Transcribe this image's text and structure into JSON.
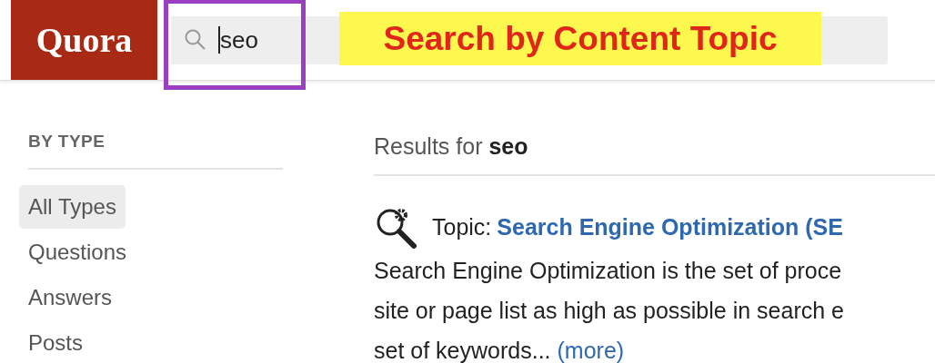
{
  "header": {
    "logo": "Quora",
    "search": {
      "value": "seo"
    }
  },
  "annotation": {
    "label": "Search by Content Topic"
  },
  "sidebar": {
    "heading": "BY TYPE",
    "items": [
      {
        "label": "All Types",
        "selected": true
      },
      {
        "label": "Questions",
        "selected": false
      },
      {
        "label": "Answers",
        "selected": false
      },
      {
        "label": "Posts",
        "selected": false
      }
    ]
  },
  "results": {
    "heading": "Results for **seo**",
    "items": [
      {
        "prefix": "Topic:",
        "title": "Search Engine Optimization (SE",
        "snippet_lines": [
          "Search Engine Optimization is the set of proce",
          "site or page list as high as possible in search e",
          "set of keywords..."
        ],
        "more": "(more)"
      }
    ]
  }
}
